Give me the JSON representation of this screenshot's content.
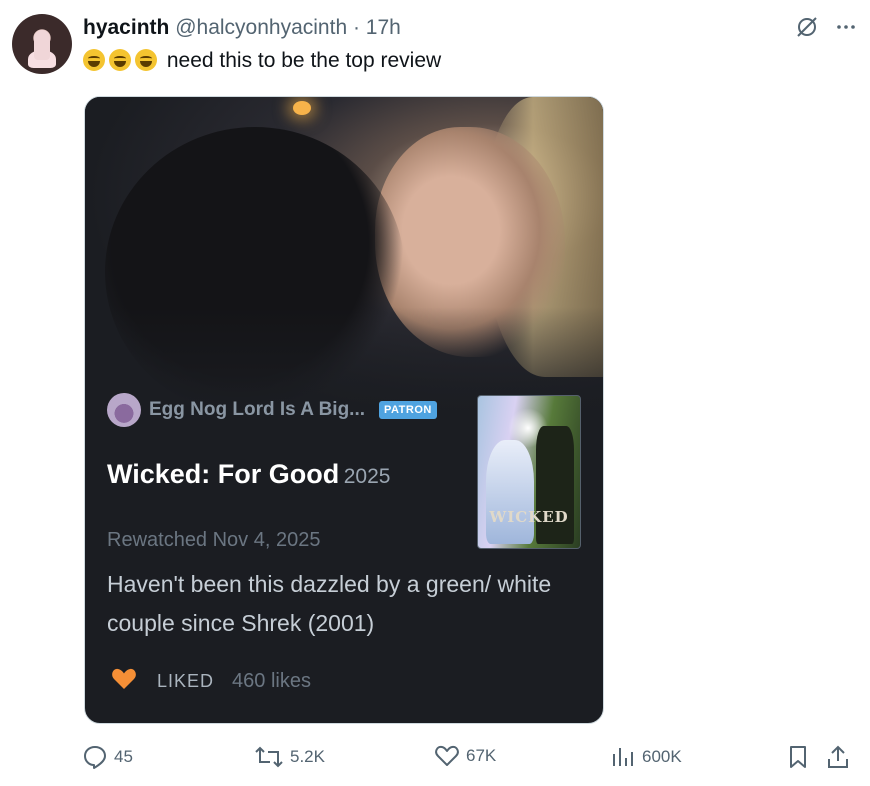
{
  "author": {
    "name": "hyacinth",
    "handle": "@halcyonhyacinth",
    "time": "· 17h"
  },
  "tweet": {
    "text": "need this to be the top review"
  },
  "card": {
    "username": "Egg Nog Lord Is A Big...",
    "badge": "PATRON",
    "film_title": "Wicked: For Good",
    "film_year": "2025",
    "rewatched": "Rewatched Nov 4, 2025",
    "review": "Haven't been this dazzled by a green/ white couple since Shrek (2001)",
    "liked_label": "LIKED",
    "likes_count": "460 likes",
    "poster_title": "WICKED"
  },
  "actions": {
    "replies": "45",
    "reposts": "5.2K",
    "likes": "67K",
    "views": "600K"
  },
  "colors": {
    "heart": "#f58f36",
    "patron_badge": "#4fa3e0",
    "card_bg": "#1b1d22"
  }
}
